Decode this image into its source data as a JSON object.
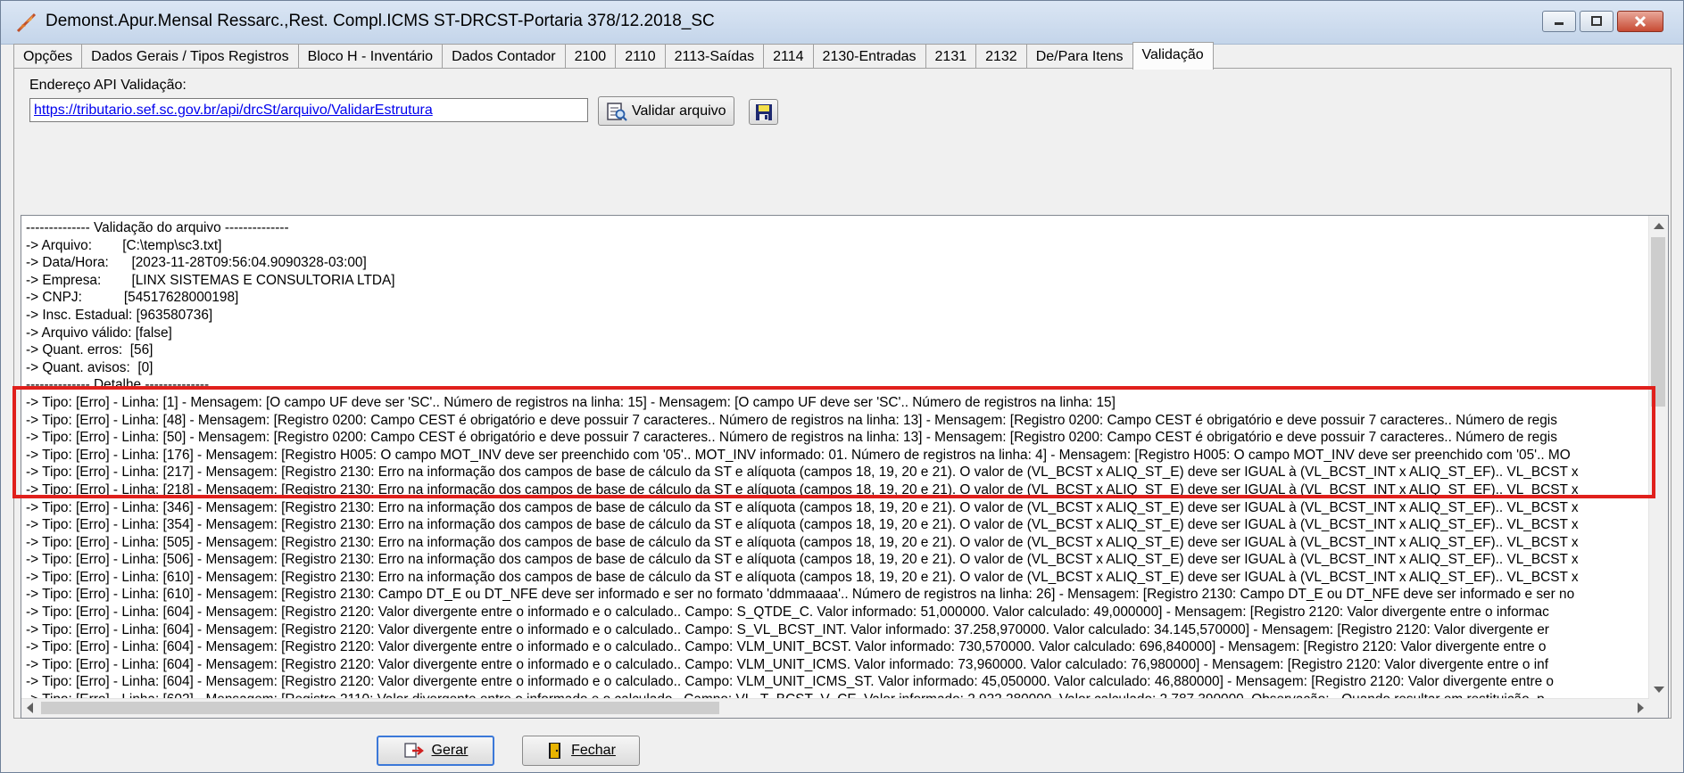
{
  "window": {
    "title": "Demonst.Apur.Mensal Ressarc.,Rest. Compl.ICMS ST-DRCST-Portaria 378/12.2018_SC"
  },
  "tabs": [
    {
      "label": "Opções"
    },
    {
      "label": "Dados Gerais / Tipos Registros"
    },
    {
      "label": "Bloco H - Inventário"
    },
    {
      "label": "Dados Contador"
    },
    {
      "label": "2100"
    },
    {
      "label": "2110"
    },
    {
      "label": "2113-Saídas"
    },
    {
      "label": "2114"
    },
    {
      "label": "2130-Entradas"
    },
    {
      "label": "2131"
    },
    {
      "label": "2132"
    },
    {
      "label": "De/Para Itens"
    },
    {
      "label": "Validação"
    }
  ],
  "active_tab": "Validação",
  "api": {
    "label": "Endereço API Validação:",
    "url": "https://tributario.sef.sc.gov.br/api/drcSt/arquivo/ValidarEstrutura"
  },
  "buttons": {
    "validate": "Validar arquivo",
    "gerar": "Gerar",
    "fechar": "Fechar"
  },
  "log_lines": [
    "-------------- Validação do arquivo --------------",
    "-> Arquivo:        [C:\\temp\\sc3.txt]",
    "-> Data/Hora:      [2023-11-28T09:56:04.9090328-03:00]",
    "-> Empresa:        [LINX SISTEMAS E CONSULTORIA LTDA]",
    "-> CNPJ:           [54517628000198]",
    "-> Insc. Estadual: [963580736]",
    "-> Arquivo válido: [false]",
    "-> Quant. erros:  [56]",
    "-> Quant. avisos:  [0]",
    "-------------- Detalhe --------------",
    "-> Tipo: [Erro] - Linha: [1] - Mensagem: [O campo UF deve ser 'SC'.. Número de registros na linha: 15] - Mensagem: [O campo UF deve ser 'SC'.. Número de registros na linha: 15]",
    "-> Tipo: [Erro] - Linha: [48] - Mensagem: [Registro 0200: Campo CEST é obrigatório e deve possuir 7 caracteres.. Número de registros na linha: 13] - Mensagem: [Registro 0200: Campo CEST é obrigatório e deve possuir 7 caracteres.. Número de regis",
    "-> Tipo: [Erro] - Linha: [50] - Mensagem: [Registro 0200: Campo CEST é obrigatório e deve possuir 7 caracteres.. Número de registros na linha: 13] - Mensagem: [Registro 0200: Campo CEST é obrigatório e deve possuir 7 caracteres.. Número de regis",
    "-> Tipo: [Erro] - Linha: [176] - Mensagem: [Registro H005: O campo MOT_INV deve ser preenchido com '05'.. MOT_INV informado: 01. Número de registros na linha: 4] - Mensagem: [Registro H005: O campo MOT_INV deve ser preenchido com '05'.. MO",
    "-> Tipo: [Erro] - Linha: [217] - Mensagem: [Registro 2130: Erro na informação dos campos de base de cálculo da ST e alíquota (campos 18, 19, 20 e 21). O valor de (VL_BCST x ALIQ_ST_E) deve ser IGUAL à (VL_BCST_INT x ALIQ_ST_EF).. VL_BCST x",
    "-> Tipo: [Erro] - Linha: [218] - Mensagem: [Registro 2130: Erro na informação dos campos de base de cálculo da ST e alíquota (campos 18, 19, 20 e 21). O valor de (VL_BCST x ALIQ_ST_E) deve ser IGUAL à (VL_BCST_INT x ALIQ_ST_EF).. VL_BCST x",
    "-> Tipo: [Erro] - Linha: [346] - Mensagem: [Registro 2130: Erro na informação dos campos de base de cálculo da ST e alíquota (campos 18, 19, 20 e 21). O valor de (VL_BCST x ALIQ_ST_E) deve ser IGUAL à (VL_BCST_INT x ALIQ_ST_EF).. VL_BCST x",
    "-> Tipo: [Erro] - Linha: [354] - Mensagem: [Registro 2130: Erro na informação dos campos de base de cálculo da ST e alíquota (campos 18, 19, 20 e 21). O valor de (VL_BCST x ALIQ_ST_E) deve ser IGUAL à (VL_BCST_INT x ALIQ_ST_EF).. VL_BCST x",
    "-> Tipo: [Erro] - Linha: [505] - Mensagem: [Registro 2130: Erro na informação dos campos de base de cálculo da ST e alíquota (campos 18, 19, 20 e 21). O valor de (VL_BCST x ALIQ_ST_E) deve ser IGUAL à (VL_BCST_INT x ALIQ_ST_EF).. VL_BCST x",
    "-> Tipo: [Erro] - Linha: [506] - Mensagem: [Registro 2130: Erro na informação dos campos de base de cálculo da ST e alíquota (campos 18, 19, 20 e 21). O valor de (VL_BCST x ALIQ_ST_E) deve ser IGUAL à (VL_BCST_INT x ALIQ_ST_EF).. VL_BCST x",
    "-> Tipo: [Erro] - Linha: [610] - Mensagem: [Registro 2130: Erro na informação dos campos de base de cálculo da ST e alíquota (campos 18, 19, 20 e 21). O valor de (VL_BCST x ALIQ_ST_E) deve ser IGUAL à (VL_BCST_INT x ALIQ_ST_EF).. VL_BCST x",
    "-> Tipo: [Erro] - Linha: [610] - Mensagem: [Registro 2130: Campo DT_E ou DT_NFE deve ser informado e ser no formato 'ddmmaaaa'.. Número de registros na linha: 26] - Mensagem: [Registro 2130: Campo DT_E ou DT_NFE deve ser informado e ser no",
    "-> Tipo: [Erro] - Linha: [604] - Mensagem: [Registro 2120: Valor divergente entre o informado e o calculado.. Campo: S_QTDE_C. Valor informado: 51,000000. Valor calculado: 49,000000] - Mensagem: [Registro 2120: Valor divergente entre o informac",
    "-> Tipo: [Erro] - Linha: [604] - Mensagem: [Registro 2120: Valor divergente entre o informado e o calculado.. Campo: S_VL_BCST_INT. Valor informado: 37.258,970000. Valor calculado: 34.145,570000] - Mensagem: [Registro 2120: Valor divergente er",
    "-> Tipo: [Erro] - Linha: [604] - Mensagem: [Registro 2120: Valor divergente entre o informado e o calculado.. Campo: VLM_UNIT_BCST. Valor informado: 730,570000. Valor calculado: 696,840000] - Mensagem: [Registro 2120: Valor divergente entre o",
    "-> Tipo: [Erro] - Linha: [604] - Mensagem: [Registro 2120: Valor divergente entre o informado e o calculado.. Campo: VLM_UNIT_ICMS. Valor informado: 73,960000. Valor calculado: 76,980000] - Mensagem: [Registro 2120: Valor divergente entre o inf",
    "-> Tipo: [Erro] - Linha: [604] - Mensagem: [Registro 2120: Valor divergente entre o informado e o calculado.. Campo: VLM_UNIT_ICMS_ST. Valor informado: 45,050000. Valor calculado: 46,880000] - Mensagem: [Registro 2120: Valor divergente entre o",
    "-> Tipo: [Erro] - Linha: [602] - Mensagem: [Registro 2110: Valor divergente entre o informado e o calculado.. Campo: VL_T_BCST_V_CE. Valor informado: 2.922,280000. Valor calculado: 2.787,390000. Observação: - Quando resultar em restituição, p"
  ],
  "colors": {
    "highlight": "#e0201c",
    "link": "#0000ee",
    "titlebar": "#c4d5ea"
  },
  "icons": [
    "app-feather-icon",
    "minimize-icon",
    "maximize-icon",
    "close-icon",
    "validate-file-icon",
    "save-disk-icon",
    "gerar-arrow-icon",
    "fechar-door-icon"
  ]
}
